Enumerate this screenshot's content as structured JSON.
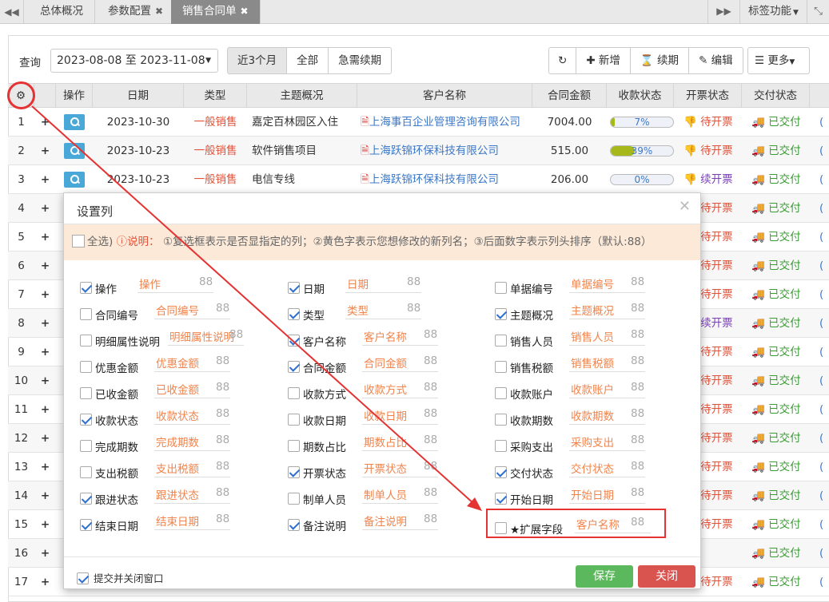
{
  "tabs": [
    {
      "label": "总体概况",
      "active": false,
      "closable": false
    },
    {
      "label": "参数配置",
      "active": false,
      "closable": true
    },
    {
      "label": "销售合同单",
      "active": true,
      "closable": true
    }
  ],
  "tabbar": {
    "tag_menu": "标签功能"
  },
  "filter": {
    "query_label": "查询",
    "date_range": "2023-08-08 至 2023-11-08",
    "range_buttons": [
      "近3个月",
      "全部",
      "急需续期"
    ],
    "active_range": "近3个月"
  },
  "toolbar": {
    "add": "新增",
    "renew": "续期",
    "edit": "编辑",
    "more": "更多"
  },
  "table": {
    "headers": [
      "操作",
      "日期",
      "类型",
      "主题概况",
      "客户名称",
      "合同金额",
      "收款状态",
      "开票状态",
      "交付状态"
    ],
    "rows": [
      {
        "num": "1",
        "date": "2023-10-30",
        "type": "一般销售",
        "subject": "嘉定百林园区入住",
        "customer": "上海事百企业管理咨询有限公司",
        "amount": "7004.00",
        "collect": "7%",
        "collect_pct": 7,
        "invoice": "待开票",
        "delivery": "已交付"
      },
      {
        "num": "2",
        "date": "2023-10-23",
        "type": "一般销售",
        "subject": "软件销售项目",
        "customer": "上海跃锦环保科技有限公司",
        "amount": "515.00",
        "collect": "39%",
        "collect_pct": 39,
        "invoice": "待开票",
        "delivery": "已交付"
      },
      {
        "num": "3",
        "date": "2023-10-23",
        "type": "一般销售",
        "subject": "电信专线",
        "customer": "上海跃锦环保科技有限公司",
        "amount": "206.00",
        "collect": "0%",
        "collect_pct": 0,
        "invoice": "续开票",
        "delivery": "已交付"
      },
      {
        "num": "4",
        "invoice": "待开票",
        "delivery": "已交付"
      },
      {
        "num": "5",
        "invoice": "待开票",
        "delivery": "已交付"
      },
      {
        "num": "6",
        "invoice": "待开票",
        "delivery": "已交付"
      },
      {
        "num": "7",
        "invoice": "待开票",
        "delivery": "已交付"
      },
      {
        "num": "8",
        "invoice": "续开票",
        "delivery": "已交付"
      },
      {
        "num": "9",
        "invoice": "待开票",
        "delivery": "已交付"
      },
      {
        "num": "10",
        "invoice": "待开票",
        "delivery": "已交付"
      },
      {
        "num": "11",
        "invoice": "待开票",
        "delivery": "已交付"
      },
      {
        "num": "12",
        "invoice": "待开票",
        "delivery": "已交付"
      },
      {
        "num": "13",
        "invoice": "待开票",
        "delivery": "已交付"
      },
      {
        "num": "14",
        "invoice": "待开票",
        "delivery": "已交付"
      },
      {
        "num": "15",
        "invoice": "待开票",
        "delivery": "已交付"
      },
      {
        "num": "16",
        "invoice": "---",
        "delivery": "已交付"
      },
      {
        "num": "17",
        "invoice": "待开票",
        "delivery": "已交付"
      }
    ]
  },
  "modal": {
    "title": "设置列",
    "select_all": "全选",
    "note_label": "说明：",
    "note_text": "①复选框表示是否显指定的列；②黄色字表示您想修改的新列名；③后面数字表示列头排序（默认:88）",
    "fields": [
      [
        {
          "name": "操作",
          "alias": "操作",
          "order": "88",
          "checked": true
        },
        {
          "name": "合同编号",
          "alias": "合同编号",
          "order": "88",
          "checked": false
        },
        {
          "name": "明细属性说明",
          "alias": "明细属性说明",
          "order": "88",
          "checked": false
        },
        {
          "name": "优惠金额",
          "alias": "优惠金额",
          "order": "88",
          "checked": false
        },
        {
          "name": "已收金额",
          "alias": "已收金额",
          "order": "88",
          "checked": false
        },
        {
          "name": "收款状态",
          "alias": "收款状态",
          "order": "88",
          "checked": true
        },
        {
          "name": "完成期数",
          "alias": "完成期数",
          "order": "88",
          "checked": false
        },
        {
          "name": "支出税额",
          "alias": "支出税额",
          "order": "88",
          "checked": false
        },
        {
          "name": "跟进状态",
          "alias": "跟进状态",
          "order": "88",
          "checked": true
        },
        {
          "name": "结束日期",
          "alias": "结束日期",
          "order": "88",
          "checked": true
        }
      ],
      [
        {
          "name": "日期",
          "alias": "日期",
          "order": "88",
          "checked": true
        },
        {
          "name": "类型",
          "alias": "类型",
          "order": "88",
          "checked": true
        },
        {
          "name": "客户名称",
          "alias": "客户名称",
          "order": "88",
          "checked": true
        },
        {
          "name": "合同金额",
          "alias": "合同金额",
          "order": "88",
          "checked": true
        },
        {
          "name": "收款方式",
          "alias": "收款方式",
          "order": "88",
          "checked": false
        },
        {
          "name": "收款日期",
          "alias": "收款日期",
          "order": "88",
          "checked": false
        },
        {
          "name": "期数占比",
          "alias": "期数占比",
          "order": "88",
          "checked": false
        },
        {
          "name": "开票状态",
          "alias": "开票状态",
          "order": "88",
          "checked": true
        },
        {
          "name": "制单人员",
          "alias": "制单人员",
          "order": "88",
          "checked": false
        },
        {
          "name": "备注说明",
          "alias": "备注说明",
          "order": "88",
          "checked": true
        }
      ],
      [
        {
          "name": "单据编号",
          "alias": "单据编号",
          "order": "88",
          "checked": false
        },
        {
          "name": "主题概况",
          "alias": "主题概况",
          "order": "88",
          "checked": true
        },
        {
          "name": "销售人员",
          "alias": "销售人员",
          "order": "88",
          "checked": false
        },
        {
          "name": "销售税额",
          "alias": "销售税额",
          "order": "88",
          "checked": false
        },
        {
          "name": "收款账户",
          "alias": "收款账户",
          "order": "88",
          "checked": false
        },
        {
          "name": "收款期数",
          "alias": "收款期数",
          "order": "88",
          "checked": false
        },
        {
          "name": "采购支出",
          "alias": "采购支出",
          "order": "88",
          "checked": false
        },
        {
          "name": "交付状态",
          "alias": "交付状态",
          "order": "88",
          "checked": true
        },
        {
          "name": "开始日期",
          "alias": "开始日期",
          "order": "88",
          "checked": true
        },
        {
          "name": "★扩展字段",
          "alias": "客户名称",
          "order": "88",
          "checked": false
        }
      ]
    ],
    "footer_check": "提交并关闭窗口",
    "save": "保存",
    "close": "关闭"
  },
  "colors": {
    "annotation": "#e53333",
    "save": "#5cb85c",
    "close": "#d9534f",
    "alias": "#f0844c"
  }
}
